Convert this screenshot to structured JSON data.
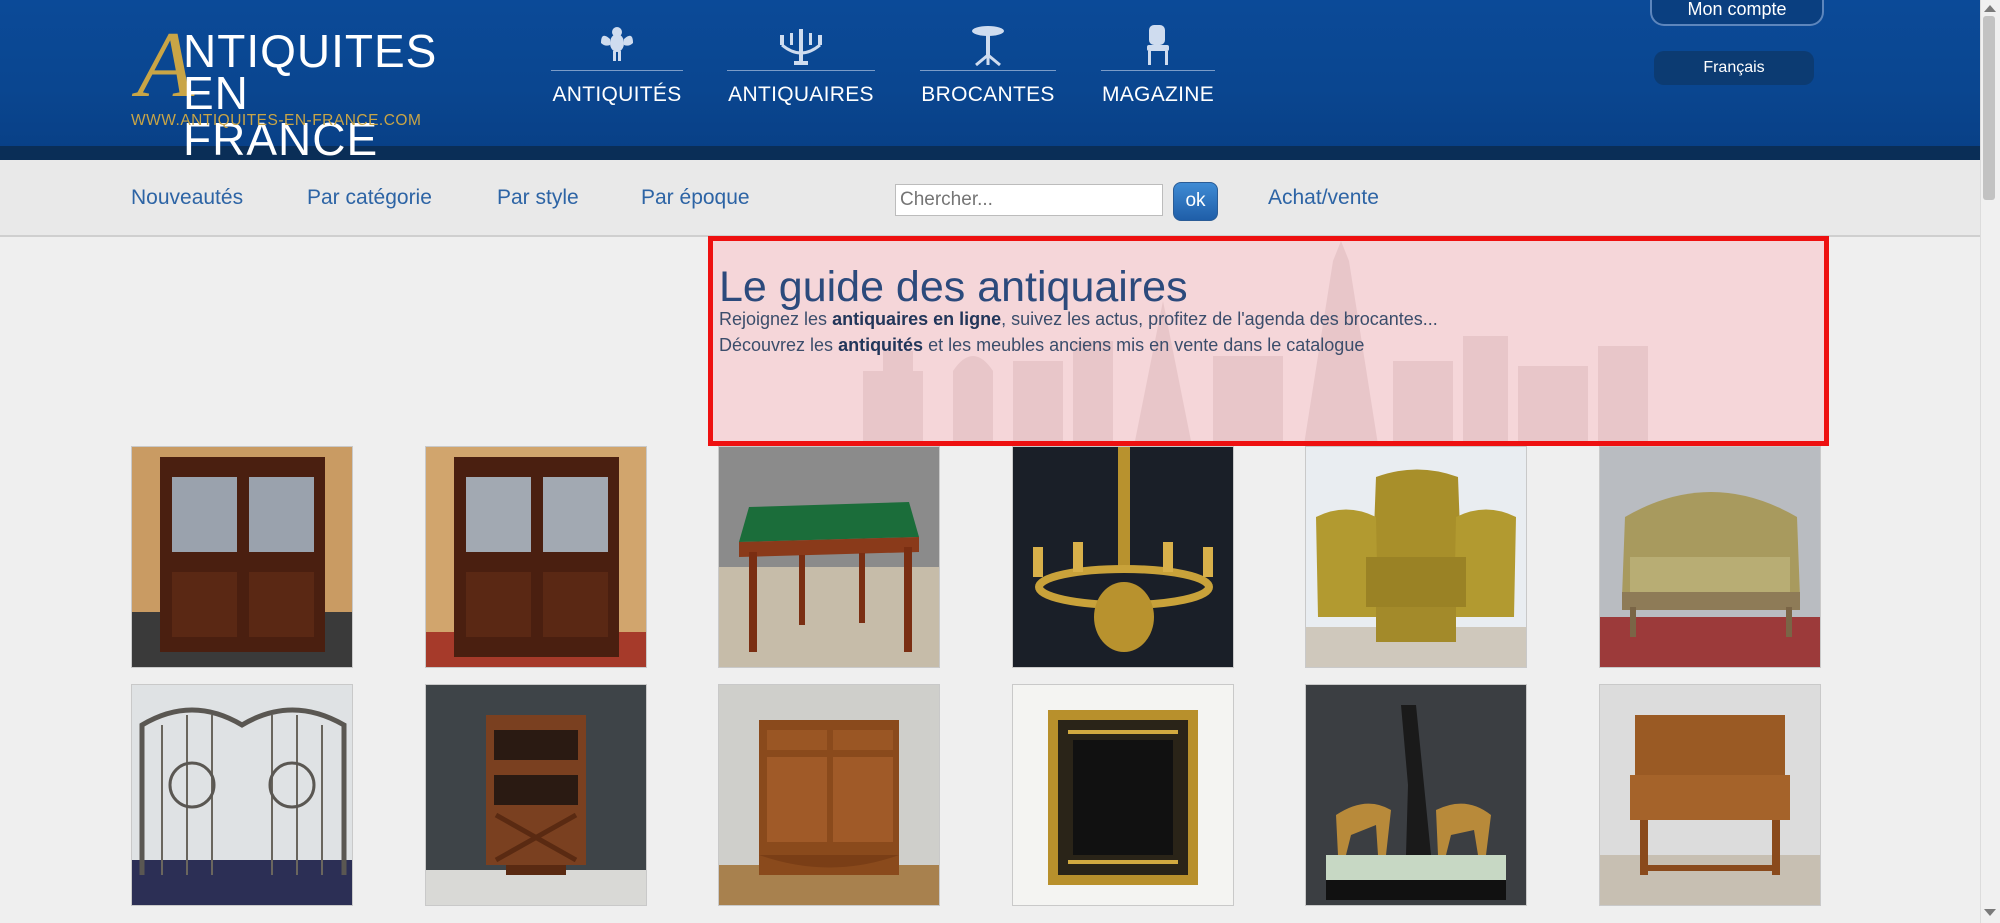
{
  "header": {
    "logo": {
      "line1": "NTIQUITES",
      "line2": "EN FRANCE",
      "initial": "A",
      "url": "WWW.ANTIQUITES-EN-FRANCE.COM"
    },
    "nav": [
      {
        "label": "ANTIQUITÉS",
        "icon": "cherub-icon"
      },
      {
        "label": "ANTIQUAIRES",
        "icon": "candelabra-icon"
      },
      {
        "label": "BROCANTES",
        "icon": "pedestal-table-icon"
      },
      {
        "label": "MAGAZINE",
        "icon": "chair-icon"
      }
    ],
    "account": "Mon compte",
    "language": "Français"
  },
  "subnav": {
    "links": [
      "Nouveautés",
      "Par catégorie",
      "Par style",
      "Par époque"
    ],
    "search_placeholder": "Chercher...",
    "search_button": "ok",
    "buy_sell": "Achat/vente"
  },
  "hero": {
    "title": "Le guide des antiquaires",
    "line1_pre": "Rejoignez les ",
    "line1_bold": "antiquaires en ligne",
    "line1_post": ", suivez les actus, profitez de l'agenda des brocantes...",
    "line2_pre": "Découvrez les ",
    "line2_bold": "antiquités",
    "line2_post": " et les meubles anciens mis en vente dans le catalogue"
  },
  "products": [
    {
      "name": "product-thumb-bookcase-buffet-1"
    },
    {
      "name": "product-thumb-bookcase-buffet-2"
    },
    {
      "name": "product-thumb-game-table"
    },
    {
      "name": "product-thumb-gilt-chandelier"
    },
    {
      "name": "product-thumb-living-room-set"
    },
    {
      "name": "product-thumb-settee"
    },
    {
      "name": "product-thumb-wrought-iron-gate"
    },
    {
      "name": "product-thumb-revolving-bookcase"
    },
    {
      "name": "product-thumb-buffet"
    },
    {
      "name": "product-thumb-gilt-mirror"
    },
    {
      "name": "product-thumb-art-deco-sculpture"
    },
    {
      "name": "product-thumb-secretary-desk"
    }
  ]
}
